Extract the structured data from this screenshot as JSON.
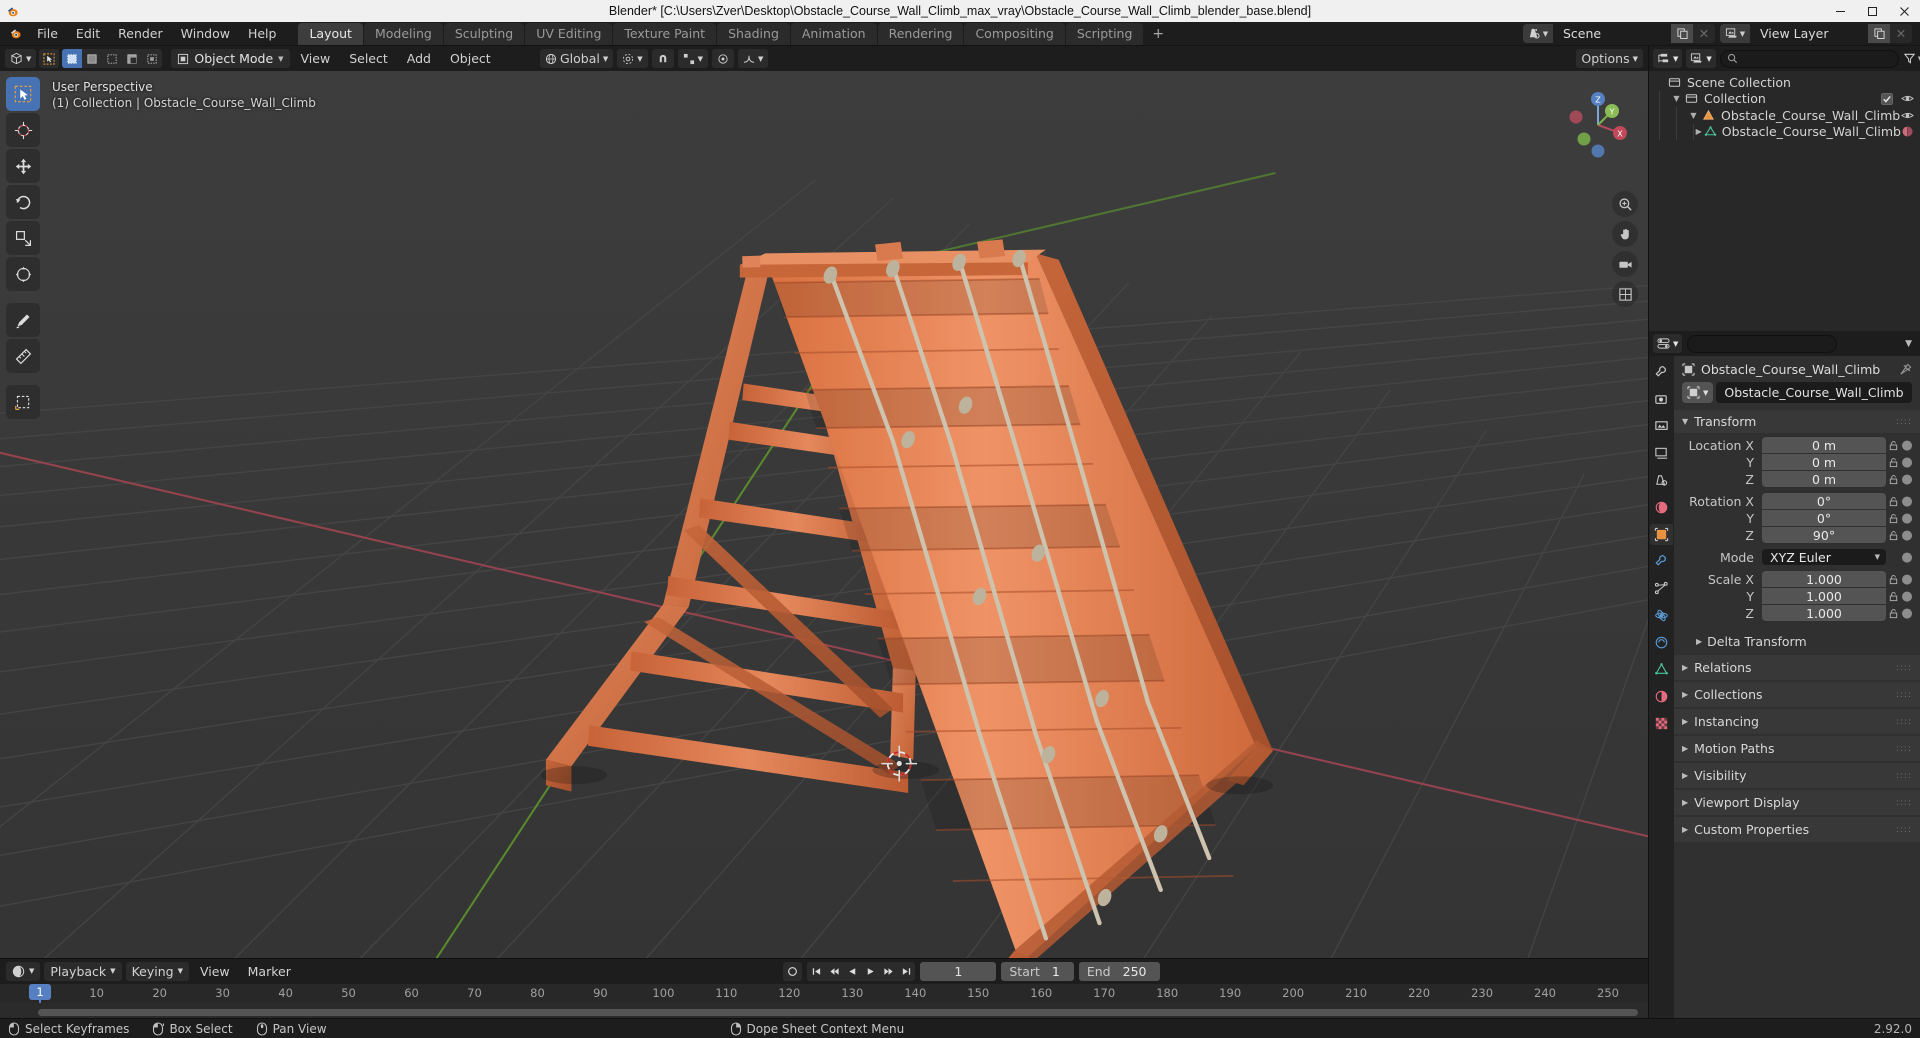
{
  "window": {
    "title": "Blender* [C:\\Users\\Zver\\Desktop\\Obstacle_Course_Wall_Climb_max_vray\\Obstacle_Course_Wall_Climb_blender_base.blend]",
    "minimize": "—",
    "maximize": "☐",
    "close": "✕"
  },
  "topbar": {
    "menus": [
      "File",
      "Edit",
      "Render",
      "Window",
      "Help"
    ],
    "workspaces": [
      {
        "label": "Layout",
        "active": true
      },
      {
        "label": "Modeling",
        "active": false
      },
      {
        "label": "Sculpting",
        "active": false
      },
      {
        "label": "UV Editing",
        "active": false
      },
      {
        "label": "Texture Paint",
        "active": false
      },
      {
        "label": "Shading",
        "active": false
      },
      {
        "label": "Animation",
        "active": false
      },
      {
        "label": "Rendering",
        "active": false
      },
      {
        "label": "Compositing",
        "active": false
      },
      {
        "label": "Scripting",
        "active": false
      }
    ],
    "add_workspace": "+",
    "scene_name": "Scene",
    "view_layer_name": "View Layer"
  },
  "viewport_header": {
    "mode": "Object Mode",
    "menus": [
      "View",
      "Select",
      "Add",
      "Object"
    ],
    "transform_orientation": "Global",
    "options_label": "Options"
  },
  "viewport": {
    "perspective_label": "User Perspective",
    "collection_label": "(1) Collection | Obstacle_Course_Wall_Climb",
    "gizmo_axes": [
      "Z",
      "Y",
      "X"
    ]
  },
  "outliner": {
    "search_placeholder": "",
    "rows": [
      {
        "label": "Scene Collection",
        "depth": 0,
        "icon": "collection-icon",
        "disclosure": "",
        "checkbox": false,
        "eye": false
      },
      {
        "label": "Collection",
        "depth": 1,
        "icon": "collection-icon",
        "disclosure": "down",
        "checkbox": true,
        "eye": true
      },
      {
        "label": "Obstacle_Course_Wall_Climb",
        "depth": 2,
        "icon": "object-icon",
        "disclosure": "down",
        "checkbox": false,
        "eye": true
      },
      {
        "label": "Obstacle_Course_Wall_Climb",
        "depth": 3,
        "icon": "mesh-data-icon",
        "disclosure": "right",
        "checkbox": false,
        "eye": false,
        "material": true
      }
    ]
  },
  "properties": {
    "breadcrumb_object": "Obstacle_Course_Wall_Climb",
    "object_name": "Obstacle_Course_Wall_Climb",
    "transform": {
      "title": "Transform",
      "fields": [
        {
          "label": "Location X",
          "value": "0 m"
        },
        {
          "label": "Y",
          "value": "0 m"
        },
        {
          "label": "Z",
          "value": "0 m"
        }
      ],
      "rotation": [
        {
          "label": "Rotation X",
          "value": "0°"
        },
        {
          "label": "Y",
          "value": "0°"
        },
        {
          "label": "Z",
          "value": "90°"
        }
      ],
      "mode_label": "Mode",
      "mode_value": "XYZ Euler",
      "scale": [
        {
          "label": "Scale X",
          "value": "1.000"
        },
        {
          "label": "Y",
          "value": "1.000"
        },
        {
          "label": "Z",
          "value": "1.000"
        }
      ],
      "delta_transform": "Delta Transform"
    },
    "panels": [
      "Relations",
      "Collections",
      "Instancing",
      "Motion Paths",
      "Visibility",
      "Viewport Display",
      "Custom Properties"
    ]
  },
  "timeline": {
    "editor_menu": "",
    "playback": "Playback",
    "keying": "Keying",
    "view": "View",
    "marker": "Marker",
    "current_frame": "1",
    "start_label": "Start",
    "start_value": "1",
    "end_label": "End",
    "end_value": "250",
    "ticks": [
      {
        "label": "1",
        "frame": 1
      },
      {
        "label": "10",
        "frame": 10
      },
      {
        "label": "20",
        "frame": 20
      },
      {
        "label": "30",
        "frame": 30
      },
      {
        "label": "40",
        "frame": 40
      },
      {
        "label": "50",
        "frame": 50
      },
      {
        "label": "60",
        "frame": 60
      },
      {
        "label": "70",
        "frame": 70
      },
      {
        "label": "80",
        "frame": 80
      },
      {
        "label": "90",
        "frame": 90
      },
      {
        "label": "100",
        "frame": 100
      },
      {
        "label": "110",
        "frame": 110
      },
      {
        "label": "120",
        "frame": 120
      },
      {
        "label": "130",
        "frame": 130
      },
      {
        "label": "140",
        "frame": 140
      },
      {
        "label": "150",
        "frame": 150
      },
      {
        "label": "160",
        "frame": 160
      },
      {
        "label": "170",
        "frame": 170
      },
      {
        "label": "180",
        "frame": 180
      },
      {
        "label": "190",
        "frame": 190
      },
      {
        "label": "200",
        "frame": 200
      },
      {
        "label": "210",
        "frame": 210
      },
      {
        "label": "220",
        "frame": 220
      },
      {
        "label": "230",
        "frame": 230
      },
      {
        "label": "240",
        "frame": 240
      },
      {
        "label": "250",
        "frame": 250
      }
    ]
  },
  "statusbar": {
    "items": [
      {
        "mouse": "left",
        "label": "Select Keyframes"
      },
      {
        "mouse": "middle",
        "label": "Box Select"
      },
      {
        "mouse": "middle2",
        "label": "Pan View"
      },
      {
        "mouse": "right",
        "label": "Dope Sheet Context Menu"
      }
    ],
    "version": "2.92.0"
  },
  "colors": {
    "accent": "#4772b3",
    "wood_light": "#e8875a",
    "wood_mid": "#d4714a",
    "wood_dark": "#b85d3c",
    "rope": "#cfc5b0",
    "grid": "#4a4a4a",
    "axis_x": "#9d4c5a",
    "axis_y": "#6b9b3a"
  }
}
